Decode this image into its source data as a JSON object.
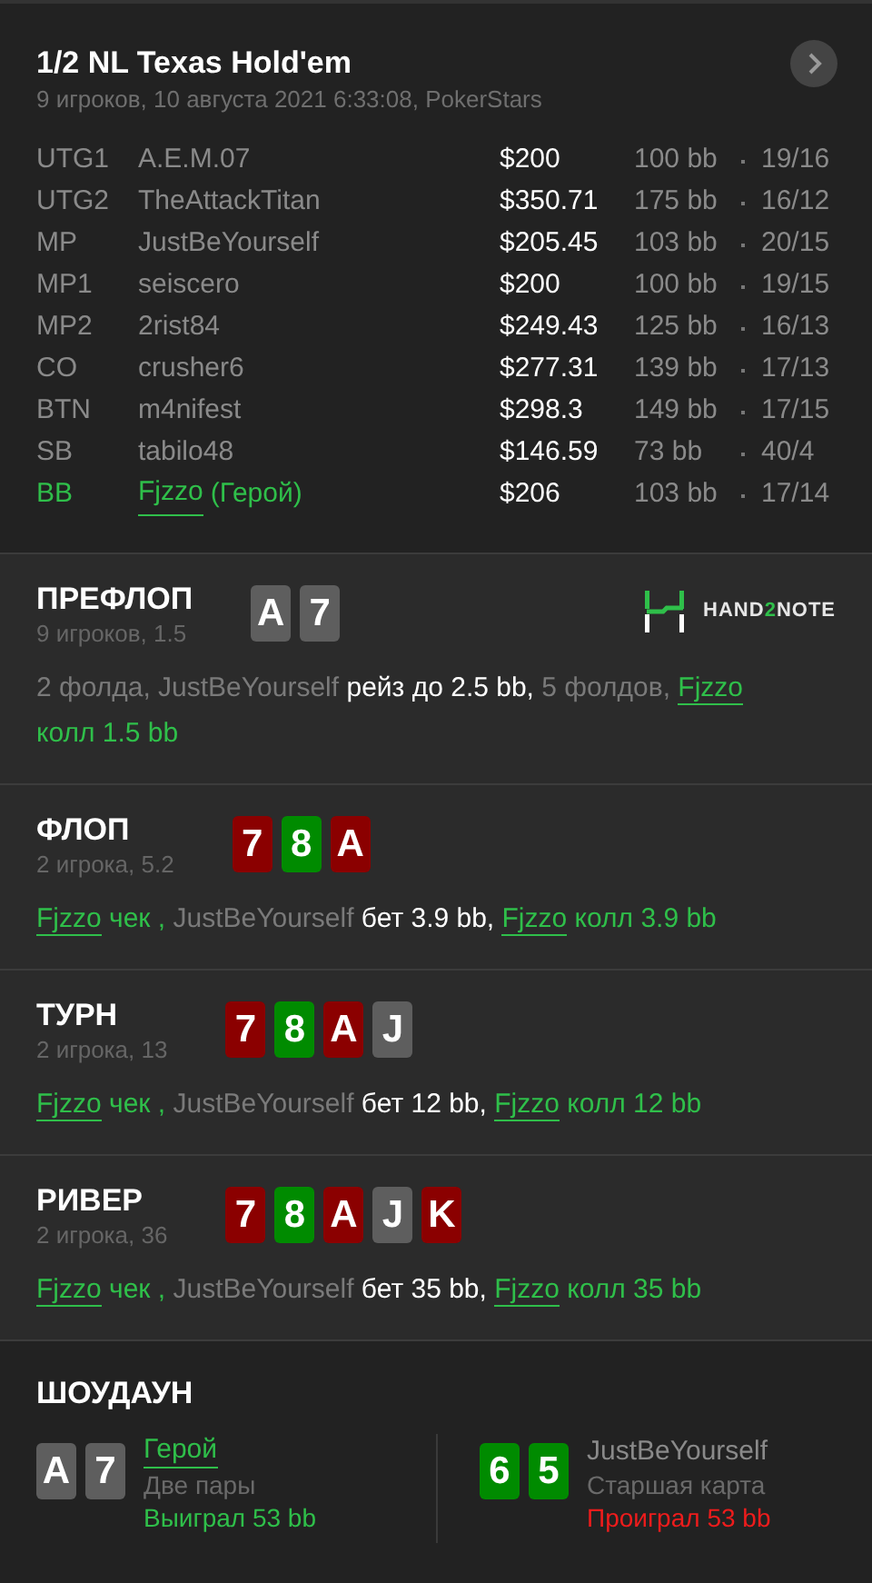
{
  "header": {
    "title": "1/2 NL Texas Hold'em",
    "subtitle": "9 игроков, 10 августа 2021 6:33:08, PokerStars"
  },
  "players": [
    {
      "position": "UTG1",
      "name": "A.E.M.07",
      "stack": "$200",
      "bb": "100 bb",
      "stats": "19/16",
      "hero": false
    },
    {
      "position": "UTG2",
      "name": "TheAttackTitan",
      "stack": "$350.71",
      "bb": "175 bb",
      "stats": "16/12",
      "hero": false
    },
    {
      "position": "MP",
      "name": "JustBeYourself",
      "stack": "$205.45",
      "bb": "103 bb",
      "stats": "20/15",
      "hero": false
    },
    {
      "position": "MP1",
      "name": "seiscero",
      "stack": "$200",
      "bb": "100 bb",
      "stats": "19/15",
      "hero": false
    },
    {
      "position": "MP2",
      "name": "2rist84",
      "stack": "$249.43",
      "bb": "125 bb",
      "stats": "16/13",
      "hero": false
    },
    {
      "position": "CO",
      "name": "crusher6",
      "stack": "$277.31",
      "bb": "139 bb",
      "stats": "17/13",
      "hero": false
    },
    {
      "position": "BTN",
      "name": "m4nifest",
      "stack": "$298.3",
      "bb": "149 bb",
      "stats": "17/15",
      "hero": false
    },
    {
      "position": "SB",
      "name": "tabilo48",
      "stack": "$146.59",
      "bb": "73 bb",
      "stats": "40/4",
      "hero": false
    },
    {
      "position": "BB",
      "name": "Fjzzo",
      "tag": "(Герой)",
      "stack": "$206",
      "bb": "103 bb",
      "stats": "17/14",
      "hero": true
    }
  ],
  "logo": [
    {
      "text": "HAND",
      "accent": false
    },
    {
      "text": "2",
      "accent": true
    },
    {
      "text": "NOTE",
      "accent": false
    }
  ],
  "streets": [
    {
      "title": "ПРЕФЛОП",
      "subtitle": "9 игроков, 1.5",
      "logo": true,
      "cards": [
        {
          "rank": "A",
          "color": "#5e5e5e"
        },
        {
          "rank": "7",
          "color": "#5e5e5e"
        }
      ],
      "actions": [
        {
          "kind": "muted",
          "text": "2 фолда, JustBeYourself "
        },
        {
          "kind": "bet",
          "text": "рейз до 2.5 bb,"
        },
        {
          "kind": "muted",
          "text": " 5 фолдов, "
        },
        {
          "kind": "hero_link",
          "text": "Fjzzo"
        },
        {
          "kind": "hero",
          "text": " колл 1.5 bb"
        }
      ]
    },
    {
      "title": "ФЛОП",
      "subtitle": "2 игрока, 5.2",
      "logo": false,
      "cards": [
        {
          "rank": "7",
          "color": "#8b0000"
        },
        {
          "rank": "8",
          "color": "#008b00"
        },
        {
          "rank": "A",
          "color": "#8b0000"
        }
      ],
      "actions": [
        {
          "kind": "hero_link",
          "text": "Fjzzo"
        },
        {
          "kind": "hero",
          "text": " чек ,"
        },
        {
          "kind": "muted",
          "text": " JustBeYourself "
        },
        {
          "kind": "bet",
          "text": "бет 3.9 bb, "
        },
        {
          "kind": "hero_link",
          "text": "Fjzzo"
        },
        {
          "kind": "hero",
          "text": " колл 3.9 bb"
        }
      ]
    },
    {
      "title": "ТУРН",
      "subtitle": "2 игрока, 13",
      "logo": false,
      "cards": [
        {
          "rank": "7",
          "color": "#8b0000"
        },
        {
          "rank": "8",
          "color": "#008b00"
        },
        {
          "rank": "A",
          "color": "#8b0000"
        },
        {
          "rank": "J",
          "color": "#5e5e5e"
        }
      ],
      "actions": [
        {
          "kind": "hero_link",
          "text": "Fjzzo"
        },
        {
          "kind": "hero",
          "text": " чек ,"
        },
        {
          "kind": "muted",
          "text": " JustBeYourself "
        },
        {
          "kind": "bet",
          "text": "бет 12 bb, "
        },
        {
          "kind": "hero_link",
          "text": "Fjzzo"
        },
        {
          "kind": "hero",
          "text": " колл 12 bb"
        }
      ]
    },
    {
      "title": "РИВЕР",
      "subtitle": "2 игрока, 36",
      "logo": false,
      "cards": [
        {
          "rank": "7",
          "color": "#8b0000"
        },
        {
          "rank": "8",
          "color": "#008b00"
        },
        {
          "rank": "A",
          "color": "#8b0000"
        },
        {
          "rank": "J",
          "color": "#5e5e5e"
        },
        {
          "rank": "K",
          "color": "#8b0000"
        }
      ],
      "actions": [
        {
          "kind": "hero_link",
          "text": "Fjzzo"
        },
        {
          "kind": "hero",
          "text": " чек ,"
        },
        {
          "kind": "muted",
          "text": " JustBeYourself "
        },
        {
          "kind": "bet",
          "text": "бет 35 bb, "
        },
        {
          "kind": "hero_link",
          "text": "Fjzzo"
        },
        {
          "kind": "hero",
          "text": " колл 35 bb"
        }
      ]
    }
  ],
  "showdown": {
    "title": "ШОУДАУН",
    "players": [
      {
        "name": "Герой",
        "hero": true,
        "hand": "Две пары",
        "result": "Выиграл 53 bb",
        "won": true,
        "cards": [
          {
            "rank": "A",
            "color": "#5e5e5e"
          },
          {
            "rank": "7",
            "color": "#5e5e5e"
          }
        ]
      },
      {
        "name": "JustBeYourself",
        "hero": false,
        "hand": "Старшая карта",
        "result": "Проиграл 53 bb",
        "won": false,
        "cards": [
          {
            "rank": "6",
            "color": "#008b00"
          },
          {
            "rank": "5",
            "color": "#008b00"
          }
        ]
      }
    ]
  }
}
